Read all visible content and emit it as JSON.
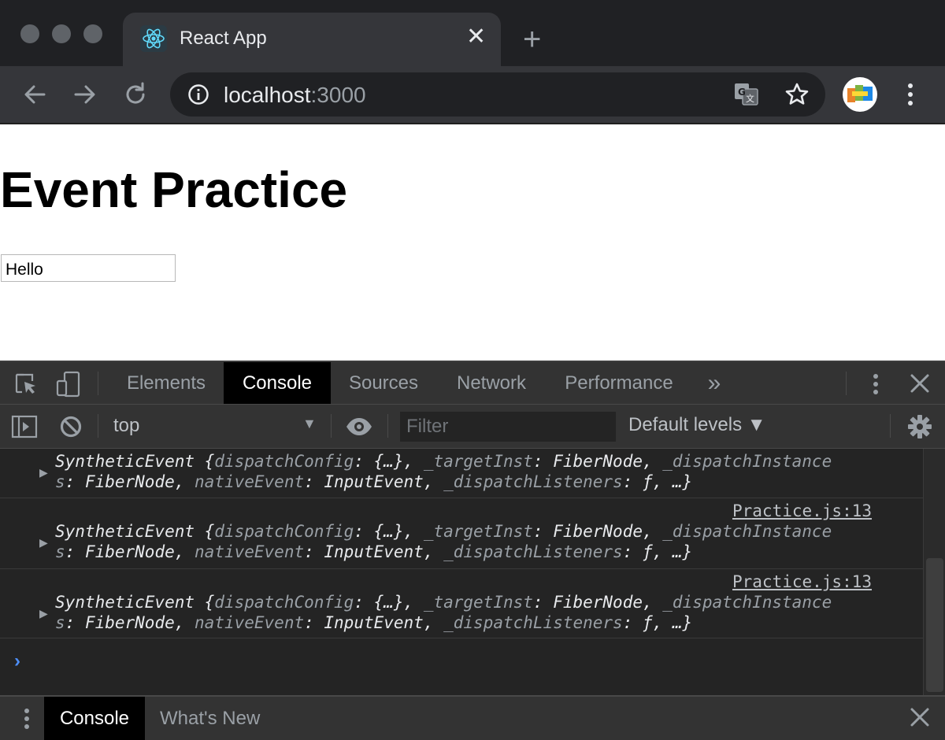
{
  "browser": {
    "tab_title": "React App",
    "tab_close_glyph": "✕",
    "new_tab_glyph": "+",
    "url_host": "localhost",
    "url_port": ":3000"
  },
  "page": {
    "heading": "Event Practice",
    "input_value": "Hello"
  },
  "devtools": {
    "tabs": [
      "Elements",
      "Console",
      "Sources",
      "Network",
      "Performance"
    ],
    "active_tab": "Console",
    "more_tabs_glyph": "»",
    "context": "top",
    "context_arrow": "▼",
    "filter_placeholder": "Filter",
    "levels_label": "Default levels ▼",
    "messages": [
      {
        "source": "",
        "line1": [
          "SyntheticEvent {",
          "dispatchConfig",
          ": {…}, ",
          "_targetInst",
          ": FiberNode, ",
          "_dispatchInstance"
        ],
        "line2": [
          "s",
          ": FiberNode, ",
          "nativeEvent",
          ": InputEvent, ",
          "_dispatchListeners",
          ": ƒ, …}"
        ]
      },
      {
        "source": "Practice.js:13",
        "line1": [
          "SyntheticEvent {",
          "dispatchConfig",
          ": {…}, ",
          "_targetInst",
          ": FiberNode, ",
          "_dispatchInstance"
        ],
        "line2": [
          "s",
          ": FiberNode, ",
          "nativeEvent",
          ": InputEvent, ",
          "_dispatchListeners",
          ": ƒ, …}"
        ]
      },
      {
        "source": "Practice.js:13",
        "line1": [
          "SyntheticEvent {",
          "dispatchConfig",
          ": {…}, ",
          "_targetInst",
          ": FiberNode, ",
          "_dispatchInstance"
        ],
        "line2": [
          "s",
          ": FiberNode, ",
          "nativeEvent",
          ": InputEvent, ",
          "_dispatchListeners",
          ": ƒ, …}"
        ]
      }
    ],
    "expand_glyph": "▶",
    "prompt_glyph": "›",
    "drawer_tabs": [
      "Console",
      "What's New"
    ],
    "drawer_active": "Console",
    "close_glyph": "✕"
  },
  "colors": {
    "chrome_dark": "#202124",
    "chrome_toolbar": "#35363a",
    "devtools_bg": "#242424",
    "prompt_blue": "#4d8ef7"
  }
}
